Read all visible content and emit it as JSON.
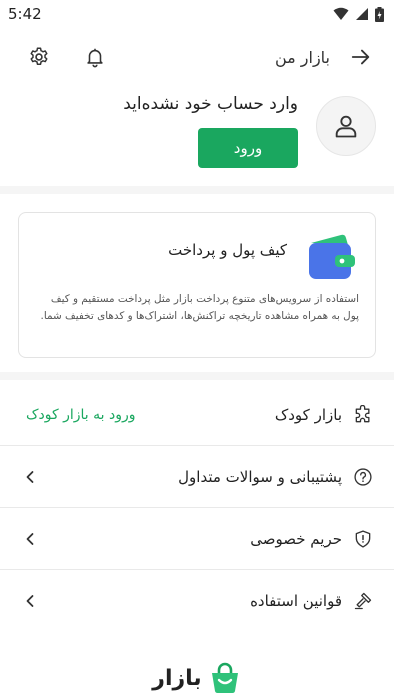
{
  "status_bar": {
    "time": "5:42"
  },
  "app_bar": {
    "title": "بازار من"
  },
  "profile": {
    "not_logged_in_text": "وارد حساب خود نشده‌اید",
    "login_label": "ورود"
  },
  "wallet": {
    "title": "کیف پول و پرداخت",
    "description": "استفاده از سرویس‌های متنوع پرداخت بازار مثل پرداخت مستقیم و کیف پول به همراه مشاهده تاریخچه تراکنش‌ها، اشتراک‌ها و کدهای تخفیف شما."
  },
  "menu": {
    "items": [
      {
        "label": "بازار کودک",
        "icon": "puzzle-icon",
        "action_label": "ورود به بازار کودک"
      },
      {
        "label": "پشتیبانی و سوالات متداول",
        "icon": "help-icon"
      },
      {
        "label": "حریم خصوصی",
        "icon": "shield-icon"
      },
      {
        "label": "قوانین استفاده",
        "icon": "gavel-icon"
      }
    ]
  },
  "brand": {
    "name": "بازار"
  },
  "colors": {
    "accent": "#1aa75f",
    "wallet_blue": "#4a74e8",
    "wallet_green": "#2fc27a"
  }
}
